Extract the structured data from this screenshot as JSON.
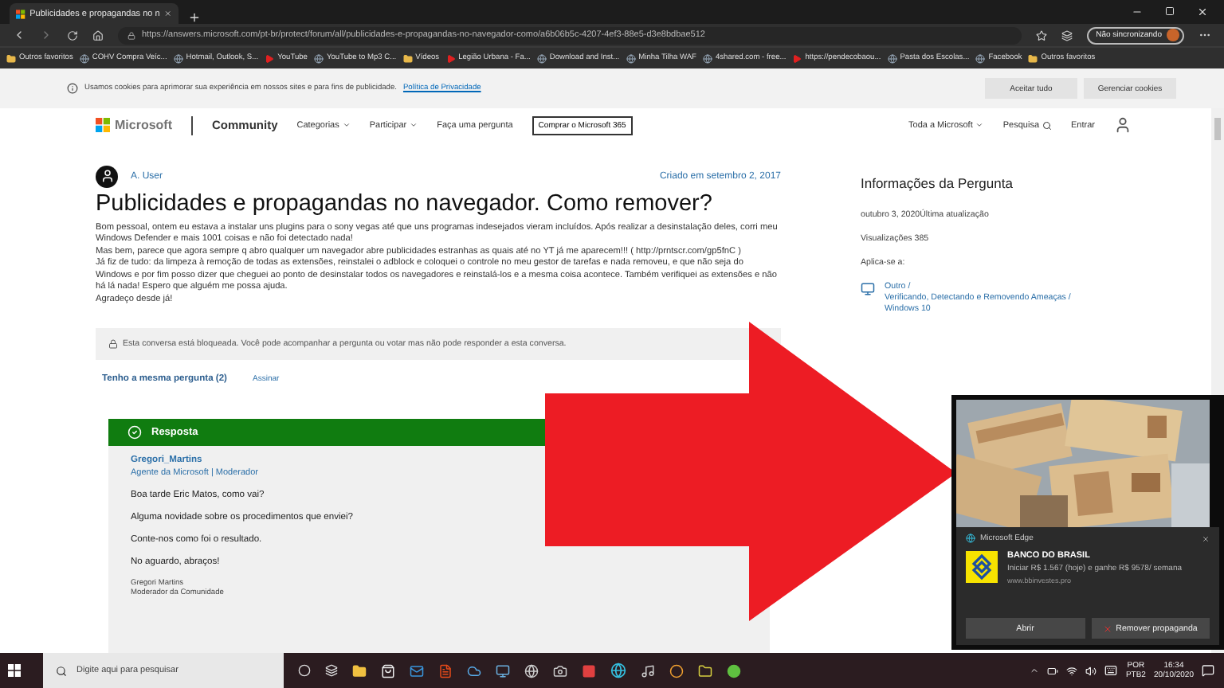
{
  "browser": {
    "tab_title": "Publicidades e propagandas no n",
    "url": "https://answers.microsoft.com/pt-br/protect/forum/all/publicidades-e-propagandas-no-navegador-como/a6b06b5c-4207-4ef3-88e5-d3e8bdbae512",
    "profile_label": "Não sincronizando",
    "bookmarks": [
      {
        "label": "Outros favoritos",
        "kind": "folder"
      },
      {
        "label": "COHV Compra Veíc...",
        "kind": "site"
      },
      {
        "label": "Hotmail, Outlook, S...",
        "kind": "site"
      },
      {
        "label": "YouTube",
        "kind": "video"
      },
      {
        "label": "YouTube to Mp3 C...",
        "kind": "site"
      },
      {
        "label": "Vídeos",
        "kind": "folder"
      },
      {
        "label": "Legião Urbana - Fa...",
        "kind": "video"
      },
      {
        "label": "Download and Inst...",
        "kind": "site"
      },
      {
        "label": "Minha Tilha WAF",
        "kind": "site"
      },
      {
        "label": "4shared.com - free...",
        "kind": "site"
      },
      {
        "label": "https://pendecobaou...",
        "kind": "video"
      },
      {
        "label": "Pasta dos Escolas...",
        "kind": "site"
      },
      {
        "label": "Facebook",
        "kind": "site"
      },
      {
        "label": "Outros favoritos",
        "kind": "folder"
      }
    ]
  },
  "cookie_banner": {
    "text": "Usamos cookies para aprimorar sua experiência em nossos sites e para fins de publicidade.",
    "link": "Política de Privacidade",
    "buttons": [
      "Aceitar tudo",
      "Gerenciar cookies"
    ]
  },
  "site_header": {
    "brand": "Microsoft",
    "section": "Community",
    "nav": [
      {
        "label": "Categorias",
        "dropdown": true
      },
      {
        "label": "Participar",
        "dropdown": true
      },
      {
        "label": "Faça uma pergunta",
        "dropdown": false
      }
    ],
    "cta": "Comprar o Microsoft 365",
    "all_microsoft": "Toda a Microsoft",
    "search": "Pesquisa",
    "sign_in": "Entrar"
  },
  "question": {
    "author": "A. User",
    "date": "Criado em setembro 2, 2017",
    "title": "Publicidades e propagandas no navegador. Como remover?",
    "paragraphs": [
      "Bom pessoal, ontem eu estava a instalar uns plugins para o sony vegas até que uns programas indesejados vieram incluídos. Após realizar a desinstalação deles, corri meu Windows Defender e mais 1001 coisas e não foi detectado nada!",
      "Mas bem, parece que agora sempre q abro qualquer um navegador abre publicidades estranhas as quais até no YT já me aparecem!!! ( http://prntscr.com/gp5fnC )",
      "Já fiz de tudo: da limpeza à remoção de todas as extensões, reinstalei o adblock e coloquei o controle no meu gestor de tarefas e nada removeu, e que não seja do Windows e por fim posso dizer que cheguei ao ponto de desinstalar todos os navegadores e reinstalá-los e a mesma coisa acontece. Também verifiquei as extensões e não há lá nada! Espero que alguém me possa ajuda.",
      "Agradeço desde já!"
    ],
    "locked_notice": "Esta conversa está bloqueada. Você pode acompanhar a pergunta ou votar mas não pode responder a esta conversa.",
    "same_question": "Tenho a mesma pergunta (2)",
    "subscribe": "Assinar"
  },
  "answer": {
    "header": "Resposta",
    "author": "Gregori_Martins",
    "role": "Agente da Microsoft | Moderador",
    "lines": [
      "Boa tarde Eric Matos, como vai?",
      "Alguma novidade sobre os procedimentos que enviei?",
      "Conte-nos como foi o resultado.",
      "No aguardo, abraços!"
    ],
    "signature": [
      "Gregori Martins",
      "Moderador da Comunidade"
    ]
  },
  "sidebar": {
    "title": "Informações da Pergunta",
    "updated": "outubro 3, 2020Última atualização",
    "views": "Visualizações 385",
    "applies_label": "Aplica-se a:",
    "applies_lines": [
      "Outro /",
      "Verificando, Detectando e Removendo Ameaças /",
      "Windows 10"
    ]
  },
  "notification": {
    "app": "Microsoft Edge",
    "title": "BANCO DO BRASIL",
    "body": "Iniciar R$ 1.567 (hoje) e ganhe R$ 9578/ semana",
    "url": "www.bbinvestes.pro",
    "buttons": [
      "Abrir",
      "Remover propaganda"
    ]
  },
  "taskbar": {
    "search_placeholder": "Digite aqui para pesquisar",
    "language": "POR",
    "layout": "PTB2",
    "time": "16:34",
    "date": "20/10/2020"
  }
}
